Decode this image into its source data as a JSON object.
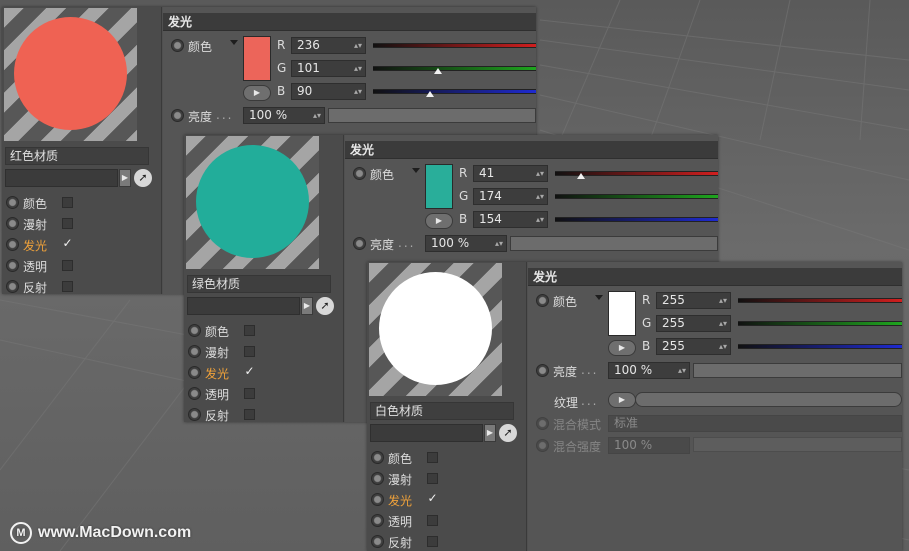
{
  "watermark": {
    "logo_glyph": "M",
    "text": "www.MacDown.com"
  },
  "materials": [
    {
      "name": "红色材质",
      "ball_color": "#ef6253",
      "channels": [
        {
          "label": "颜色",
          "checked": false,
          "active": false
        },
        {
          "label": "漫射",
          "checked": false,
          "active": false
        },
        {
          "label": "发光",
          "checked": true,
          "active": true
        },
        {
          "label": "透明",
          "checked": false,
          "active": false
        },
        {
          "label": "反射",
          "checked": false,
          "active": false
        }
      ],
      "section_title": "发光",
      "color_label": "颜色",
      "swatch": "#ec655a",
      "rgb": [
        {
          "ch": "R",
          "value": "236",
          "level": 1.0
        },
        {
          "ch": "G",
          "value": "101",
          "level": 0.4
        },
        {
          "ch": "B",
          "value": "90",
          "level": 0.35
        }
      ],
      "brightness_label": "亮度",
      "brightness_value": "100 %"
    },
    {
      "name": "绿色材质",
      "ball_color": "#22ad9a",
      "channels": [
        {
          "label": "颜色",
          "checked": false,
          "active": false
        },
        {
          "label": "漫射",
          "checked": false,
          "active": false
        },
        {
          "label": "发光",
          "checked": true,
          "active": true
        },
        {
          "label": "透明",
          "checked": false,
          "active": false
        },
        {
          "label": "反射",
          "checked": false,
          "active": false
        }
      ],
      "section_title": "发光",
      "color_label": "颜色",
      "swatch": "#29ae9a",
      "rgb": [
        {
          "ch": "R",
          "value": "41",
          "level": 0.16
        },
        {
          "ch": "G",
          "value": "174",
          "level": 1.0
        },
        {
          "ch": "B",
          "value": "154",
          "level": 1.0
        }
      ],
      "brightness_label": "亮度",
      "brightness_value": "100 %"
    },
    {
      "name": "白色材质",
      "ball_color": "#ffffff",
      "channels": [
        {
          "label": "颜色",
          "checked": false,
          "active": false
        },
        {
          "label": "漫射",
          "checked": false,
          "active": false
        },
        {
          "label": "发光",
          "checked": true,
          "active": true
        },
        {
          "label": "透明",
          "checked": false,
          "active": false
        },
        {
          "label": "反射",
          "checked": false,
          "active": false
        }
      ],
      "section_title": "发光",
      "color_label": "颜色",
      "swatch": "#ffffff",
      "rgb": [
        {
          "ch": "R",
          "value": "255",
          "level": 1.0
        },
        {
          "ch": "G",
          "value": "255",
          "level": 1.0
        },
        {
          "ch": "B",
          "value": "255",
          "level": 1.0
        }
      ],
      "brightness_label": "亮度",
      "brightness_value": "100 %",
      "texture_label": "纹理",
      "blend_mode_label": "混合模式",
      "blend_mode_value": "标准",
      "blend_strength_label": "混合强度",
      "blend_strength_value": "100 %"
    }
  ],
  "colors": {
    "red_track": "#d01e1e",
    "green_track": "#1ea51e",
    "blue_track": "#1e2ad0",
    "active_channel": "#f0a23a"
  }
}
